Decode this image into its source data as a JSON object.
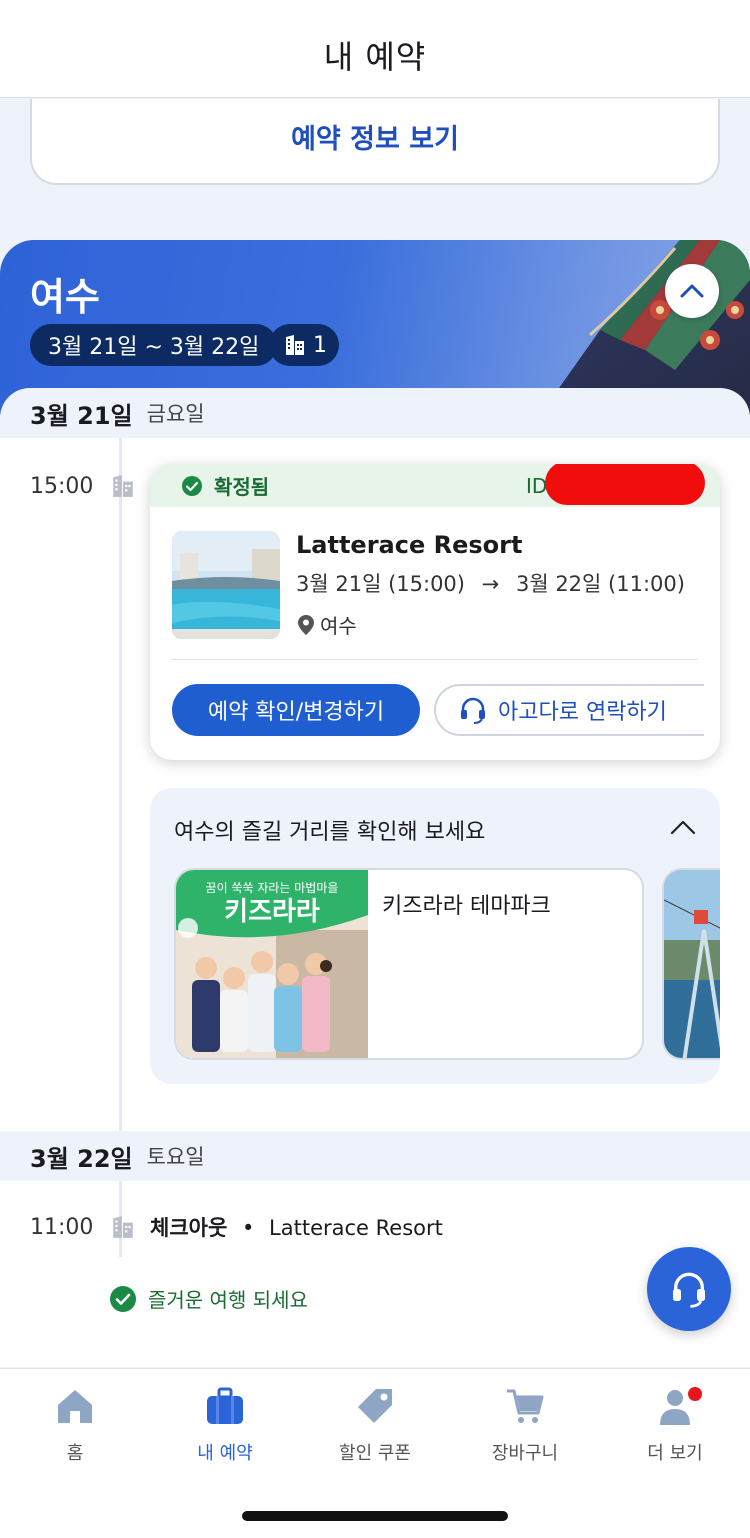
{
  "header": {
    "title": "내 예약"
  },
  "prev_card": {
    "link_label": "예약 정보 보기"
  },
  "trip": {
    "city": "여수",
    "date_range": "3월 21일 ~ 3월 22일",
    "count": "1",
    "collapse_icon": "chevron-up-icon"
  },
  "days": [
    {
      "date": "3월 21일",
      "weekday": "금요일"
    },
    {
      "date": "3월 22일",
      "weekday": "토요일"
    }
  ],
  "reservation": {
    "time": "15:00",
    "status": "확정됨",
    "id_label": "ID",
    "hotel_name": "Latterace Resort",
    "checkin": "3월 21일 (15:00)",
    "arrow": "→",
    "checkout": "3월 22일 (11:00)",
    "location": "여수",
    "confirm_button": "예약 확인/변경하기",
    "contact_button": "아고다로 연락하기"
  },
  "things_to_do": {
    "title": "여수의 즐길 거리를 확인해 보세요",
    "items": [
      {
        "name": "키즈라라 테마파크",
        "image_text": "꿈이 쑥쑥 자라는 마법마을",
        "image_logo": "키즈라라"
      }
    ]
  },
  "checkout_item": {
    "time": "11:00",
    "label": "체크아웃",
    "separator": "•",
    "hotel": "Latterace Resort",
    "message": "즐거운 여행 되세요"
  },
  "tabs": [
    {
      "label": "홈",
      "icon": "home-icon"
    },
    {
      "label": "내 예약",
      "icon": "suitcase-icon",
      "active": true
    },
    {
      "label": "할인 쿠폰",
      "icon": "tag-icon"
    },
    {
      "label": "장바구니",
      "icon": "cart-icon"
    },
    {
      "label": "더 보기",
      "icon": "profile-icon",
      "badge": true
    }
  ],
  "colors": {
    "primary": "#2b63d9",
    "confirmed": "#1a6b34",
    "badge": "#e8141e"
  }
}
